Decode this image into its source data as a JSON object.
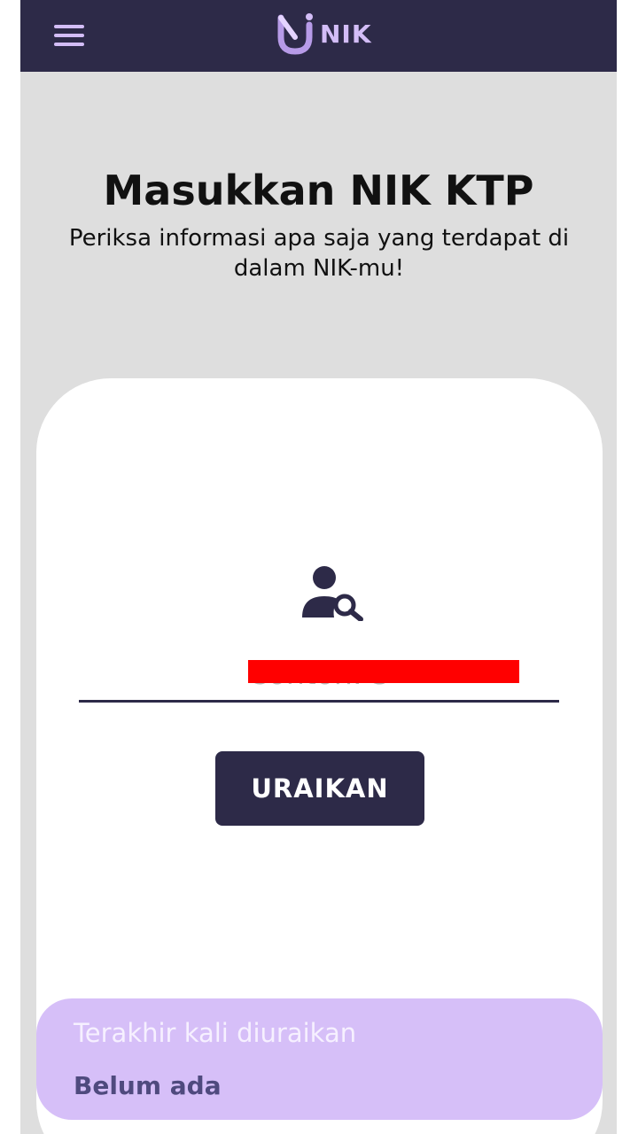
{
  "app": {
    "brand_text": "NIK",
    "colors": {
      "navbar": "#2d2a48",
      "accent": "#d3bdf7",
      "background": "#dedede",
      "card": "#ffffff",
      "history_bg": "#d6bff8",
      "redaction": "#ff0000"
    }
  },
  "header": {
    "menu_icon": "hamburger-menu-icon",
    "logo_icon": "uj-logo-icon"
  },
  "main": {
    "title": "Masukkan NIK KTP",
    "subtitle": "Periksa informasi apa saja yang terdapat di dalam NIK-mu!",
    "form": {
      "icon": "user-search-icon",
      "input_value": "",
      "input_placeholder": "Contoh: 3",
      "submit_label": "URAIKAN"
    },
    "history": {
      "label": "Terakhir kali diuraikan",
      "value": "Belum ada"
    }
  }
}
